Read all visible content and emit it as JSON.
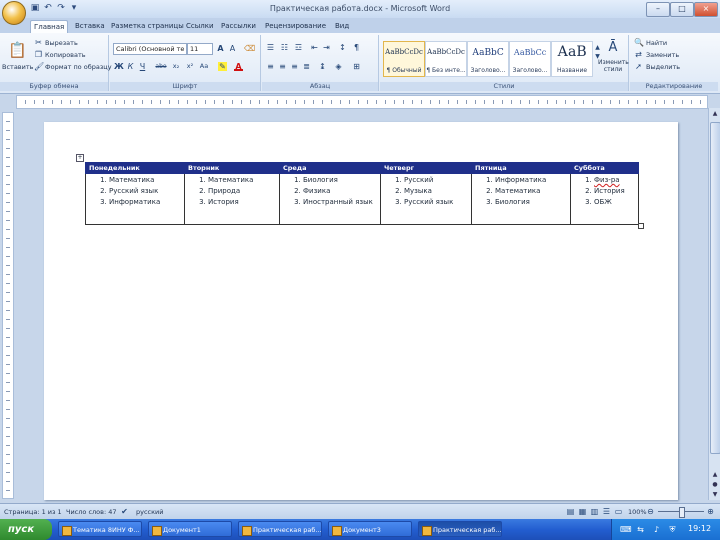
{
  "window": {
    "title": "Практическая работа.docx - Microsoft Word",
    "qat_icons": [
      "save-icon",
      "undo-icon",
      "redo-icon",
      "customize-icon"
    ],
    "controls": [
      "–",
      "□",
      "×"
    ]
  },
  "tabs": [
    "Главная",
    "Вставка",
    "Разметка страницы",
    "Ссылки",
    "Рассылки",
    "Рецензирование",
    "Вид"
  ],
  "active_tab": "Главная",
  "ribbon": {
    "clipboard": {
      "paste": "Вставить",
      "cut": "Вырезать",
      "copy": "Копировать",
      "format_painter": "Формат по образцу",
      "label": "Буфер обмена"
    },
    "font": {
      "name": "Calibri (Основной те",
      "size": "11",
      "label": "Шрифт",
      "buttons": [
        "Ж",
        "К",
        "Ч",
        "abe",
        "x₂",
        "x²",
        "Aa",
        "A",
        "A"
      ]
    },
    "paragraph": {
      "label": "Абзац"
    },
    "styles": {
      "items": [
        {
          "sample": "АаBbCcDc",
          "name": "¶ Обычный",
          "selected": true
        },
        {
          "sample": "АаBbCcDc",
          "name": "¶ Без инте..."
        },
        {
          "sample": "АаBbC",
          "name": "Заголово..."
        },
        {
          "sample": "АаBbCc",
          "name": "Заголово..."
        },
        {
          "sample": "АаВ",
          "name": "Название"
        }
      ],
      "change": "Изменить стили",
      "label": "Стили"
    },
    "editing": {
      "find": "Найти",
      "replace": "Заменить",
      "select": "Выделить",
      "label": "Редактирование"
    }
  },
  "table": {
    "headers": [
      "Понедельник",
      "Вторник",
      "Среда",
      "Четверг",
      "Пятница",
      "Суббота"
    ],
    "columns": [
      [
        "Математика",
        "Русский язык",
        "Информатика"
      ],
      [
        "Математика",
        "Природа",
        "История"
      ],
      [
        "Биология",
        "Физика",
        "Иностранный язык"
      ],
      [
        "Русский",
        "Музыка",
        "Русский язык"
      ],
      [
        "Информатика",
        "Математика",
        "Биология"
      ],
      [
        "Физ-ра",
        "История",
        "ОБЖ"
      ]
    ]
  },
  "status": {
    "page": "Страница: 1 из 1",
    "words": "Число слов: 47",
    "language": "русский",
    "zoom": "100%"
  },
  "taskbar": {
    "start": "пуск",
    "tasks": [
      "Тематика 8ИНУ Ф...",
      "Документ1",
      "Практическая раб...",
      "Документ3",
      "Практическая раб..."
    ],
    "active_task": 4,
    "clock": "19:12"
  }
}
